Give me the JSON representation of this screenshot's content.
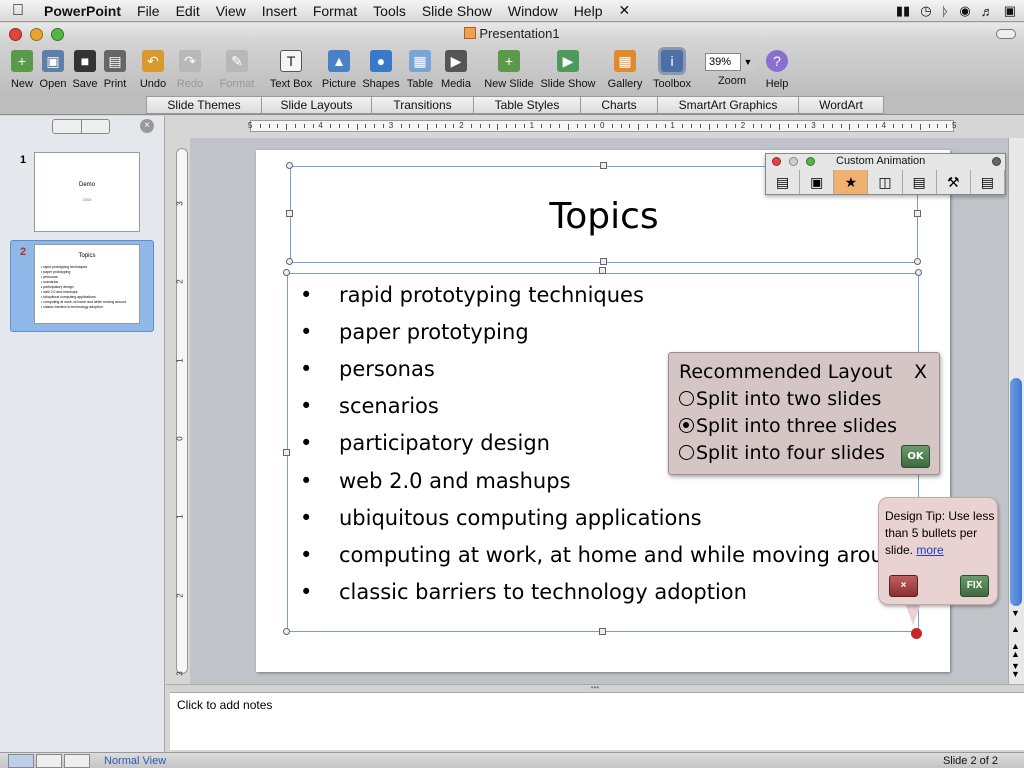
{
  "menubar": {
    "apple": "",
    "app": "PowerPoint",
    "items": [
      "File",
      "Edit",
      "View",
      "Insert",
      "Format",
      "Tools",
      "Slide Show",
      "Window",
      "Help"
    ]
  },
  "window": {
    "title": "Presentation1"
  },
  "toolbar": {
    "new": "New",
    "open": "Open",
    "save": "Save",
    "print": "Print",
    "undo": "Undo",
    "redo": "Redo",
    "format": "Format",
    "textbox": "Text Box",
    "picture": "Picture",
    "shapes": "Shapes",
    "table": "Table",
    "media": "Media",
    "newslide": "New Slide",
    "slideshow": "Slide Show",
    "gallery": "Gallery",
    "toolbox": "Toolbox",
    "zoom": "Zoom",
    "zoom_value": "39%",
    "help": "Help"
  },
  "ribbon": {
    "tabs": [
      "Slide Themes",
      "Slide Layouts",
      "Transitions",
      "Table Styles",
      "Charts",
      "SmartArt Graphics",
      "WordArt"
    ]
  },
  "thumbs": {
    "n1": "1",
    "n2": "2",
    "t1_title": "Demo",
    "t1_sub": "2008",
    "t2_title": "Topics",
    "t2_lines": [
      "rapid prototyping techniques",
      "paper prototyping",
      "personas",
      "scenarios",
      "participatory design",
      "web 2.0 and mashups",
      "ubiquitous computing applications",
      "computing at work, at home and while moving around",
      "classic barriers to technology adoption"
    ]
  },
  "ruler": {
    "h_labels": [
      "5",
      "4",
      "3",
      "2",
      "1",
      "0",
      "1",
      "2",
      "3",
      "4",
      "5"
    ],
    "v_labels": [
      "3",
      "2",
      "1",
      "0",
      "1",
      "2",
      "3"
    ]
  },
  "slide": {
    "title": "Topics",
    "bullets": [
      "rapid prototyping techniques",
      "paper prototyping",
      "personas",
      "scenarios",
      "participatory design",
      "web 2.0 and mashups",
      "ubiquitous computing applications",
      "computing at work, at home and while moving around",
      "classic barriers to technology adoption"
    ],
    "bullet_char": "•"
  },
  "anim": {
    "title": "Custom Animation"
  },
  "reclayout": {
    "title": "Recommended Layout",
    "close": "X",
    "options": [
      "Split into two slides",
      "Split into three slides",
      "Split into four slides"
    ],
    "selected_index": 1,
    "ok": "OK"
  },
  "tip": {
    "text": "Design Tip:  Use less than 5 bullets per slide.",
    "more": "more",
    "dismiss": "×",
    "fix": "FIX"
  },
  "notes": {
    "placeholder": "Click to add notes"
  },
  "status": {
    "view": "Normal View",
    "slide_count": "Slide 2 of 2"
  },
  "colors": {
    "selection": "#7a9fd8",
    "popup_bg": "#d6c5c5",
    "tip_bg": "#e9d2d2",
    "ok_green": "#4f7f4f",
    "dismiss_red": "#a04040"
  }
}
